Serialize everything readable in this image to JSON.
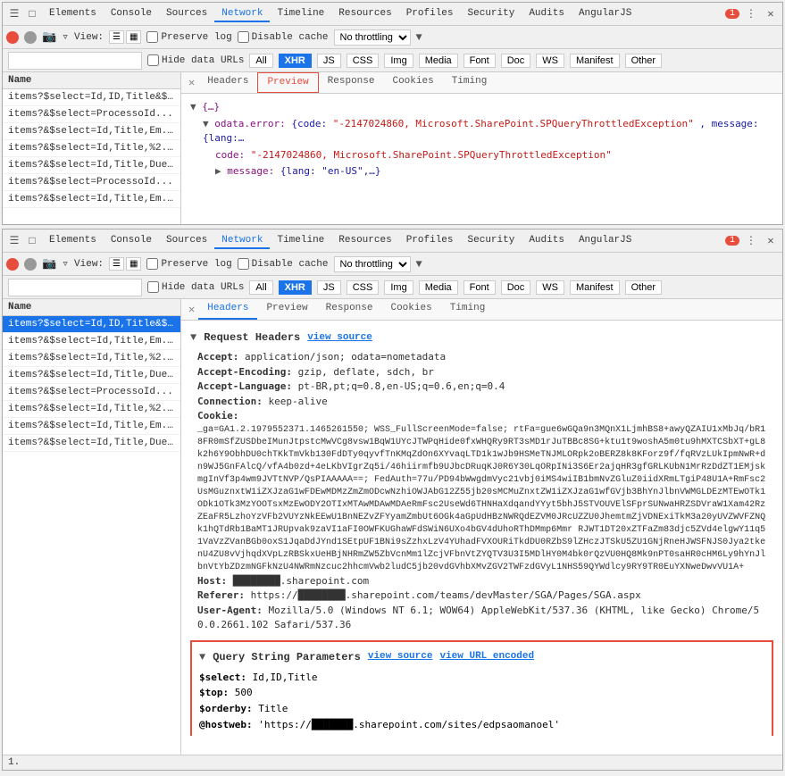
{
  "panels": {
    "top": {
      "nav_tabs": [
        "Elements",
        "Console",
        "Sources",
        "Network",
        "Timeline",
        "Resources",
        "Profiles",
        "Security",
        "Audits",
        "AngularJS"
      ],
      "active_tab": "Network",
      "error_count": "1",
      "toolbar": {
        "preserve_log": "Preserve log",
        "disable_cache": "Disable cache",
        "throttle": "No throttling"
      },
      "filter_row": {
        "placeholder": "",
        "hide_data_urls": "Hide data URLs",
        "all_btn": "All",
        "xhr_btn": "XHR",
        "js_btn": "JS",
        "css_btn": "CSS",
        "img_btn": "Img",
        "media_btn": "Media",
        "font_btn": "Font",
        "doc_btn": "Doc",
        "ws_btn": "WS",
        "manifest_btn": "Manifest",
        "other_btn": "Other"
      },
      "list": {
        "header": "Name",
        "items": [
          "items?$select=Id,ID,Title&$...",
          "items?&$select=ProcessoId...",
          "items?&$select=Id,Title,Em...",
          "items?&$select=Id,Title,%2...",
          "items?&$select=Id,Title,Due...",
          "items?&$select=ProcessoId...",
          "items?&$select=Id,Title,Em..."
        ]
      },
      "sub_tabs": [
        "Headers",
        "Preview",
        "Response",
        "Cookies",
        "Timing"
      ],
      "active_sub_tab": "Preview",
      "preview": {
        "line1": "▼ {…}",
        "line2": "▼ odata.error: {code: \"-2147024860, Microsoft.SharePoint.SPQueryThrottledException\", message: {lang:…",
        "line3": "code: \"-2147024860, Microsoft.SharePoint.SPQueryThrottledException\"",
        "line4": "▶ message: {lang: \"en-US\",…}"
      }
    },
    "bottom": {
      "nav_tabs": [
        "Elements",
        "Console",
        "Sources",
        "Network",
        "Timeline",
        "Resources",
        "Profiles",
        "Security",
        "Audits",
        "AngularJS"
      ],
      "active_tab": "Network",
      "error_count": "1",
      "toolbar": {
        "preserve_log": "Preserve log",
        "disable_cache": "Disable cache",
        "throttle": "No throttling"
      },
      "filter_row": {
        "placeholder": "",
        "hide_data_urls": "Hide data URLs",
        "all_btn": "All",
        "xhr_btn": "XHR",
        "js_btn": "JS",
        "css_btn": "CSS",
        "img_btn": "Img",
        "media_btn": "Media",
        "font_btn": "Font",
        "doc_btn": "Doc",
        "ws_btn": "WS",
        "manifest_btn": "Manifest",
        "other_btn": "Other"
      },
      "list": {
        "header": "Name",
        "items": [
          "items?$select=Id,ID,Title&$...",
          "items?&$select=Id,Title,Em...",
          "items?&$select=Id,Title,%2...",
          "items?&$select=Id,Title,Due...",
          "items?&$select=ProcessoId...",
          "items?&$select=Id,Title,%2...",
          "items?&$select=Id,Title,Em...",
          "items?&$select=Id,Title,Due..."
        ]
      },
      "sub_tabs": [
        "Headers",
        "Preview",
        "Response",
        "Cookies",
        "Timing"
      ],
      "active_sub_tab": "Headers",
      "headers": {
        "section_title": "Request Headers",
        "view_source_link": "view source",
        "rows": [
          {
            "name": "Accept:",
            "value": "application/json; odata=nometadata"
          },
          {
            "name": "Accept-Encoding:",
            "value": "gzip, deflate, sdch, br"
          },
          {
            "name": "Accept-Language:",
            "value": "pt-BR,pt;q=0.8,en-US;q=0.6,en;q=0.4"
          },
          {
            "name": "Connection:",
            "value": "keep-alive"
          },
          {
            "name": "Cookie:",
            "value": "_ga=GA1.2.1979552371.1465261550; WSS_FullScreenMode=false; rtFa=gue6wGQa9n3MQnX1LjmhBS8+awyQZAIU1xMbJq/bR18FR0mSfZUSDbeIMunJtpstcMwVCg8vsw1BqW1UYcJTWPqHide0fxWHQRy9RT3sMD1rJuTBBc8SG+ktu1t9woshA5m0tu9hMXTCSbXT+gL8k2h6Y9ObhDU0chTKkTmVkb130FdDTy0qyvfTnKMqZdOn6XYvaqLTD1k1wJb9HSMeTNJMLORpk2oBERZ8k8KForz9f/fqRVzLUkIpmNwR+dn9WJ5GnFAlcQ/vfA4b0zd+4eLKbVIgrZq5i/46hiirmfb9UJbcDRuqKJ0R6Y30LqORpINi3S6Er2ajqHR3gfGRLKUbN1MrRzDdZT1EMjskmgInVf3p4wm9JVTtNVP/QsPIAAAAA==; FedAuth=77u/PD94bWwgdmVyc21vbj0iMS4wiIB1bmNvZGluZ0iidXRmLTgiP48U1A+RmFsc2UsMGuznxtW1iZXJzaG1wFDEwMDMzZmZmODcwNzhiOWJAbG12Z55jb20sMCMuZnxtZW1iZXJzaG1wfGVjb3BhYnJlbnVWMGLDEzMTEwOTk1ODk1OTk3MzYOOTsxMzEwODY2OTIxMTAwMDAwMDAeRmFsc2UseWd6THNHaXdqandYYyt5bhJ5STVOUVElSFprSUNwaHRZSDVraW1Xam42RzZEaFR5LzhoYzVFb2VUYzNkEEwU1BnNEZvZFYyamZmbUt6OGk4aGpUdHBzNWRQdEZVM0JRcUZZU0JhemtmZjVDNExiTkM3a20yUVZWVFZNQk1hQTdRb1BaMT1JRUpvak9zaVI1aFI0OWFKUGhaWFdSWiN6UXo4bGV4dUhoRThDMmp6Mmr RJWT1DT20xZTFaZm83djc5ZVd4elgwY11q51VaVzZVanBGb0oxS1JqaDdJYnd1SEtpUF1BNi9sZzhxLzV4YUhadFVXOURiTkdDU0RZbS9lZHczJTSkU5ZU1GNjRneHJWSFNJS0Jya2tkenU4ZU8vVjhqdXVpLzRBSkxUeHBjNHRmZW5ZbVcnMm1lZcjVFbnVtZYQTV3U3I5MDlHY0M4bk0rQzVU0HQ8Mk9nPT0saHR0cHM6Ly9hYnJlbnVtYbZDzmNGFkNzU4NWRmNzcuc2hhcmVwb2ludC5jb20vdGVhbXMvZGV2TWFzdGVyL1NHS59QYWdlcy9RY9TR0EuYXNweDwvVU1A+"
          },
          {
            "name": "Host:",
            "value": "████████.sharepoint.com"
          },
          {
            "name": "Referer:",
            "value": "https://████████.sharepoint.com/teams/devMaster/SGA/Pages/SGA.aspx"
          },
          {
            "name": "User-Agent:",
            "value": "Mozilla/5.0 (Windows NT 6.1; WOW64) AppleWebKit/537.36 (KHTML, like Gecko) Chrome/50.0.2661.102 Safari/537.36"
          }
        ]
      },
      "query_params": {
        "section_title": "Query String Parameters",
        "view_source_link": "view source",
        "view_url_link": "view URL encoded",
        "params": [
          {
            "name": "$select:",
            "value": "Id,ID,Title"
          },
          {
            "name": "$top:",
            "value": "500"
          },
          {
            "name": "$orderby:",
            "value": "Title"
          },
          {
            "name": "@hostweb:",
            "value": "'https://███████.sharepoint.com/sites/edpsaomanoel'"
          }
        ]
      },
      "status_bar": "1."
    }
  }
}
